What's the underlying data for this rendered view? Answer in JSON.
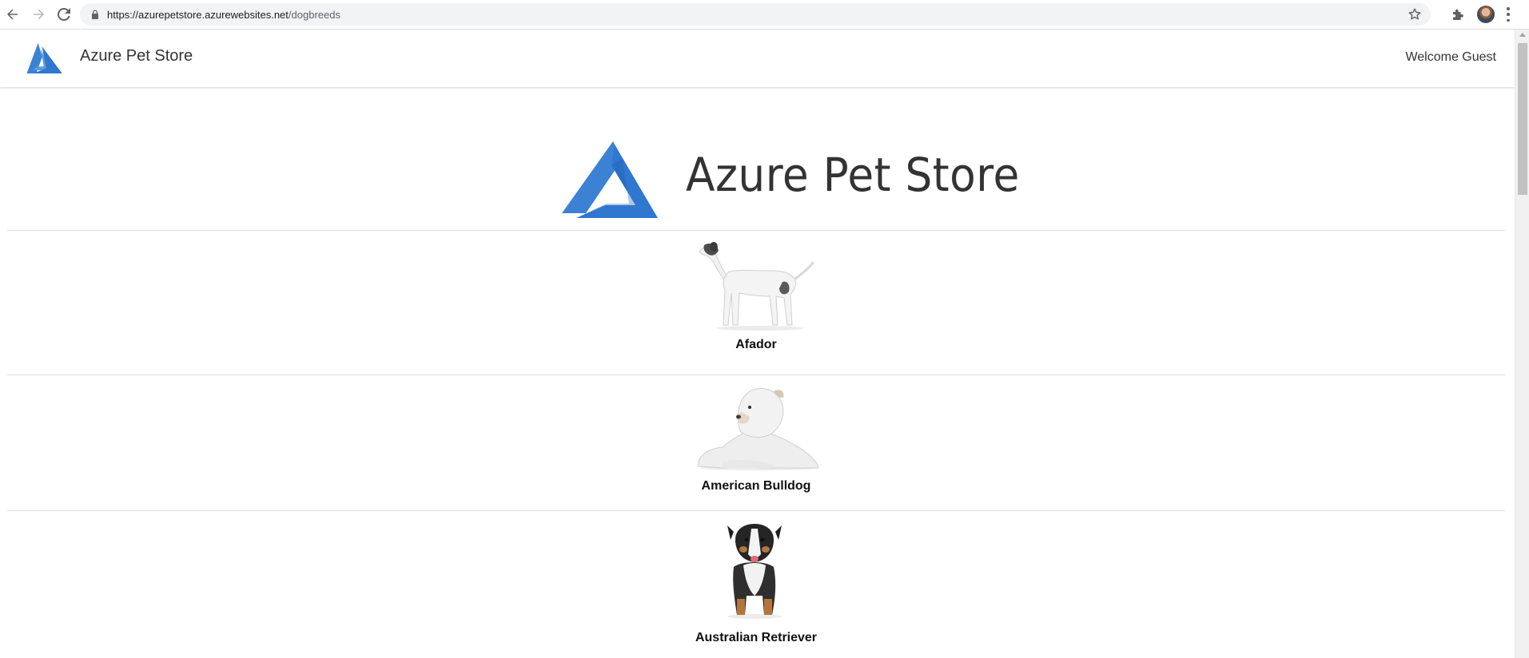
{
  "browser": {
    "url_host": "https://azurepetstore.azurewebsites.net",
    "url_path": "/dogbreeds",
    "icons": {
      "back": "back-arrow-icon",
      "forward": "forward-arrow-icon",
      "reload": "reload-icon",
      "lock": "lock-icon",
      "bookmark": "star-icon",
      "extensions": "puzzle-icon",
      "menu": "kebab-menu-icon"
    }
  },
  "navbar": {
    "brand": "Azure Pet Store",
    "welcome": "Welcome Guest"
  },
  "hero": {
    "title": "Azure Pet Store"
  },
  "breeds": [
    {
      "name": "Afador"
    },
    {
      "name": "American Bulldog"
    },
    {
      "name": "Australian Retriever"
    }
  ],
  "colors": {
    "azure_blue": "#3c82d4",
    "azure_blue_dark": "#2a6bbd",
    "divider": "#dddddd",
    "omnibox": "#f1f3f4"
  }
}
